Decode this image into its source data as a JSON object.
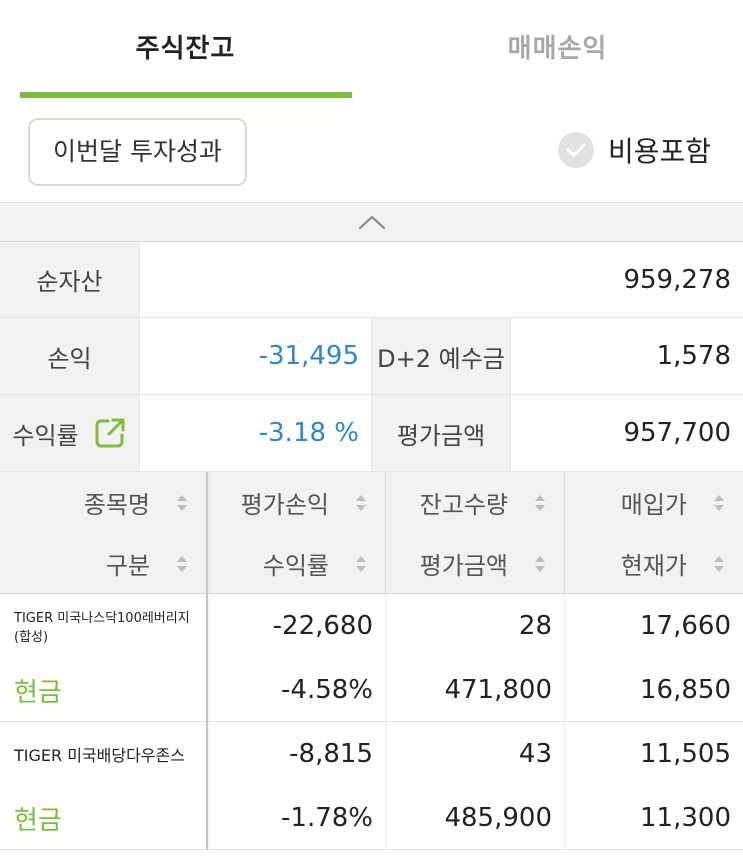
{
  "tabs": [
    {
      "label": "주식잔고",
      "active": true
    },
    {
      "label": "매매손익",
      "active": false
    }
  ],
  "controls": {
    "performance_button": "이번달 투자성과",
    "include_fees_label": "비용포함",
    "include_fees_checked": false
  },
  "summary": {
    "net_assets_label": "순자산",
    "net_assets_value": "959,278",
    "pnl_label": "손익",
    "pnl_value": "-31,495",
    "deposit_label": "D+2 예수금",
    "deposit_value": "1,578",
    "return_label": "수익률",
    "return_value": "-3.18 %",
    "eval_label": "평가금액",
    "eval_value": "957,700"
  },
  "table": {
    "headers_row1": [
      "종목명",
      "평가손익",
      "잔고수량",
      "매입가"
    ],
    "headers_row2": [
      "구분",
      "수익률",
      "평가금액",
      "현재가"
    ],
    "rows": [
      {
        "name": "TIGER 미국나스닥100레버리지(합성)",
        "type": "현금",
        "eval_pnl": "-22,680",
        "return_rate": "-4.58%",
        "quantity": "28",
        "eval_amount": "471,800",
        "buy_price": "17,660",
        "current_price": "16,850"
      },
      {
        "name": "TIGER 미국배당다우존스",
        "type": "현금",
        "eval_pnl": "-8,815",
        "return_rate": "-1.78%",
        "quantity": "43",
        "eval_amount": "485,900",
        "buy_price": "11,505",
        "current_price": "11,300"
      }
    ]
  },
  "colors": {
    "accent_green": "#7cbf3c",
    "negative_blue": "#2f86d6",
    "price_teal": "#23a889",
    "label_bg": "#f2f2f2"
  },
  "icons": {
    "collapse": "chevron-up-icon",
    "check": "check-circle-icon",
    "external": "external-link-icon",
    "sort": "sort-icon"
  }
}
